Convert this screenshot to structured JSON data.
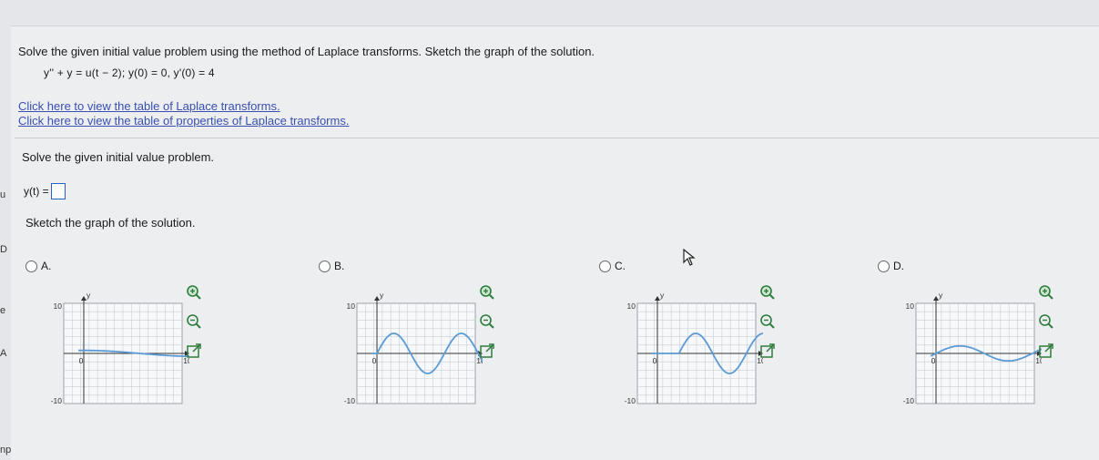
{
  "question": {
    "prompt": "Solve the given initial value problem using the method of Laplace transforms. Sketch the graph of the solution.",
    "equation": "y'' + y = u(t − 2);   y(0) = 0,   y'(0) = 4",
    "links": [
      "Click here to view the table of Laplace transforms.",
      "Click here to view the table of properties of Laplace transforms."
    ]
  },
  "part1": {
    "instruction": "Solve the given initial value problem.",
    "answer_label": "y(t) =",
    "answer_value": ""
  },
  "part2": {
    "instruction": "Sketch the graph of the solution."
  },
  "options": [
    {
      "label": "A.",
      "curve": "flat"
    },
    {
      "label": "B.",
      "curve": "sine-from-zero"
    },
    {
      "label": "C.",
      "curve": "flat-then-sine"
    },
    {
      "label": "D.",
      "curve": "small-wave"
    }
  ],
  "graph": {
    "y_label": "y",
    "x_label": "t",
    "y_max_label": "10",
    "y_min_label": "-10",
    "x_max_label": "10",
    "origin_label": "0"
  },
  "tools": [
    "zoom-in-icon",
    "zoom-out-icon",
    "open-external-icon"
  ],
  "edge_text": [
    "u",
    "D",
    "e",
    "A",
    "np"
  ],
  "colors": {
    "link": "#3a4fb0",
    "curve": "#5b9bd5",
    "input_border": "#2a61c9"
  }
}
